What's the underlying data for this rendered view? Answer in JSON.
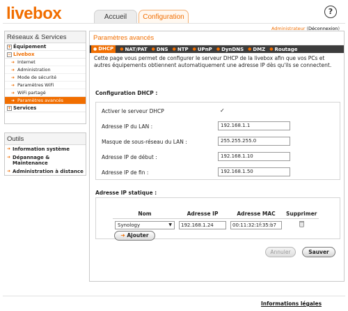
{
  "header": {
    "logo": "livebox",
    "tabs": [
      {
        "label": "Accueil"
      },
      {
        "label": "Configuration"
      }
    ],
    "help": "?",
    "user": {
      "role": "Administrateur",
      "logout": "Déconnexion"
    }
  },
  "sidebar": {
    "title": "Réseaux & Services",
    "equipement": "Équipement",
    "livebox": "Livebox",
    "items": [
      {
        "label": "Internet"
      },
      {
        "label": "Administration"
      },
      {
        "label": "Mode de sécurité"
      },
      {
        "label": "Paramètres WiFi"
      },
      {
        "label": "WiFi partagé"
      },
      {
        "label": "Paramètres avancés"
      }
    ],
    "services": "Services"
  },
  "tools": {
    "title": "Outils",
    "items": [
      {
        "label": "Information système"
      },
      {
        "label": "Dépannage &\nMaintenance"
      },
      {
        "label": "Administration à distance"
      }
    ]
  },
  "main": {
    "title": "Paramètres avancés",
    "subnav": [
      "DHCP",
      "NAT/PAT",
      "DNS",
      "NTP",
      "UPnP",
      "DynDNS",
      "DMZ",
      "Routage"
    ],
    "intro": "Cette page vous permet de configurer le serveur DHCP de la livebox afin que vos PCs et autres équipements obtiennent automatiquement une adresse IP dès qu'ils se connectent.",
    "dhcp_title": "Configuration DHCP :",
    "dhcp": {
      "enable_label": "Activer le serveur DHCP",
      "enabled": true,
      "check": "✓",
      "lan_ip_label": "Adresse IP du LAN :",
      "lan_ip": "192.168.1.1",
      "mask_label": "Masque de sous-réseau du LAN :",
      "mask": "255.255.255.0",
      "start_label": "Adresse IP de début :",
      "start": "192.168.1.10",
      "end_label": "Adresse IP de fin :",
      "end": "192.168.1.50"
    },
    "static_title": "Adresse IP statique :",
    "static_table": {
      "headers": [
        "Nom",
        "Adresse IP",
        "Adresse MAC",
        "Supprimer"
      ],
      "row": {
        "name": "Synology",
        "ip": "192.168.1.24",
        "mac": "00:11:32:1f:35:b7"
      }
    },
    "add_button": "Ajouter",
    "cancel_button": "Annuler",
    "save_button": "Sauver"
  },
  "footer": {
    "legal": "Informations légales"
  },
  "colors": {
    "accent": "#f16e00",
    "subnav_bg": "#3c3c3c"
  }
}
